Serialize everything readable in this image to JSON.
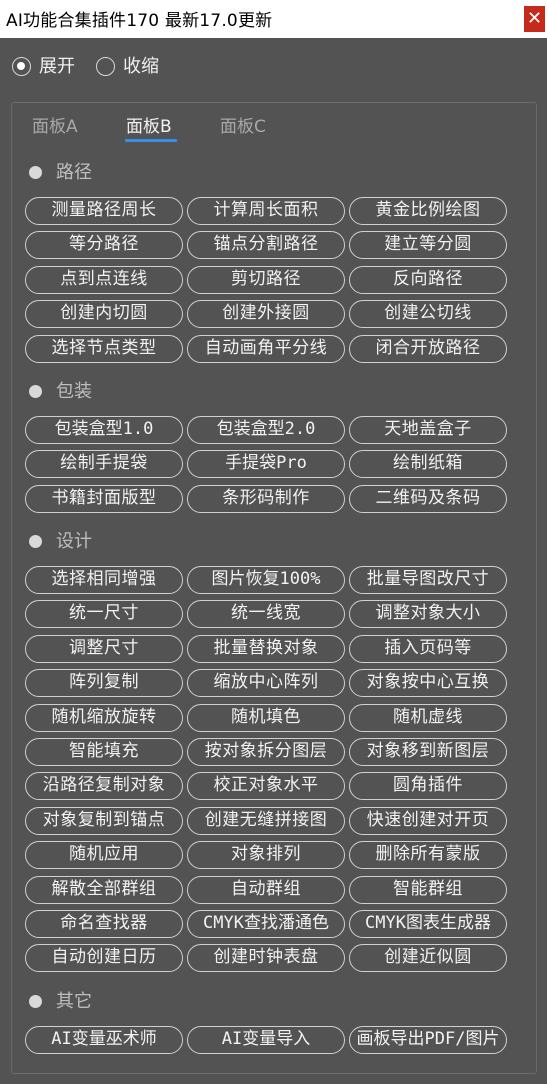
{
  "window": {
    "title": "AI功能合集插件170 最新17.0更新",
    "close_glyph": "✕"
  },
  "mode": {
    "options": [
      {
        "label": "展开",
        "selected": true
      },
      {
        "label": "收缩",
        "selected": false
      }
    ]
  },
  "tabs": [
    {
      "label": "面板A",
      "active": false
    },
    {
      "label": "面板B",
      "active": true
    },
    {
      "label": "面板C",
      "active": false
    }
  ],
  "sections": [
    {
      "name": "路径",
      "buttons": [
        "测量路径周长",
        "计算周长面积",
        "黄金比例绘图",
        "等分路径",
        "锚点分割路径",
        "建立等分圆",
        "点到点连线",
        "剪切路径",
        "反向路径",
        "创建内切圆",
        "创建外接圆",
        "创建公切线",
        "选择节点类型",
        "自动画角平分线",
        "闭合开放路径"
      ]
    },
    {
      "name": "包装",
      "buttons": [
        "包装盒型1.0",
        "包装盒型2.0",
        "天地盖盒子",
        "绘制手提袋",
        "手提袋Pro",
        "绘制纸箱",
        "书籍封面版型",
        "条形码制作",
        "二维码及条码"
      ]
    },
    {
      "name": "设计",
      "buttons": [
        "选择相同增强",
        "图片恢复100%",
        "批量导图改尺寸",
        "统一尺寸",
        "统一线宽",
        "调整对象大小",
        "调整尺寸",
        "批量替换对象",
        "插入页码等",
        "阵列复制",
        "缩放中心阵列",
        "对象按中心互换",
        "随机缩放旋转",
        "随机填色",
        "随机虚线",
        "智能填充",
        "按对象拆分图层",
        "对象移到新图层",
        "沿路径复制对象",
        "校正对象水平",
        "圆角插件",
        "对象复制到锚点",
        "创建无缝拼接图",
        "快速创建对开页",
        "随机应用",
        "对象排列",
        "删除所有蒙版",
        "解散全部群组",
        "自动群组",
        "智能群组",
        "命名查找器",
        "CMYK查找潘通色",
        "CMYK图表生成器",
        "自动创建日历",
        "创建时钟表盘",
        "创建近似圆"
      ]
    },
    {
      "name": "其它",
      "buttons": [
        "AI变量巫术师",
        "AI变量导入",
        "画板导出PDF/图片"
      ]
    }
  ]
}
